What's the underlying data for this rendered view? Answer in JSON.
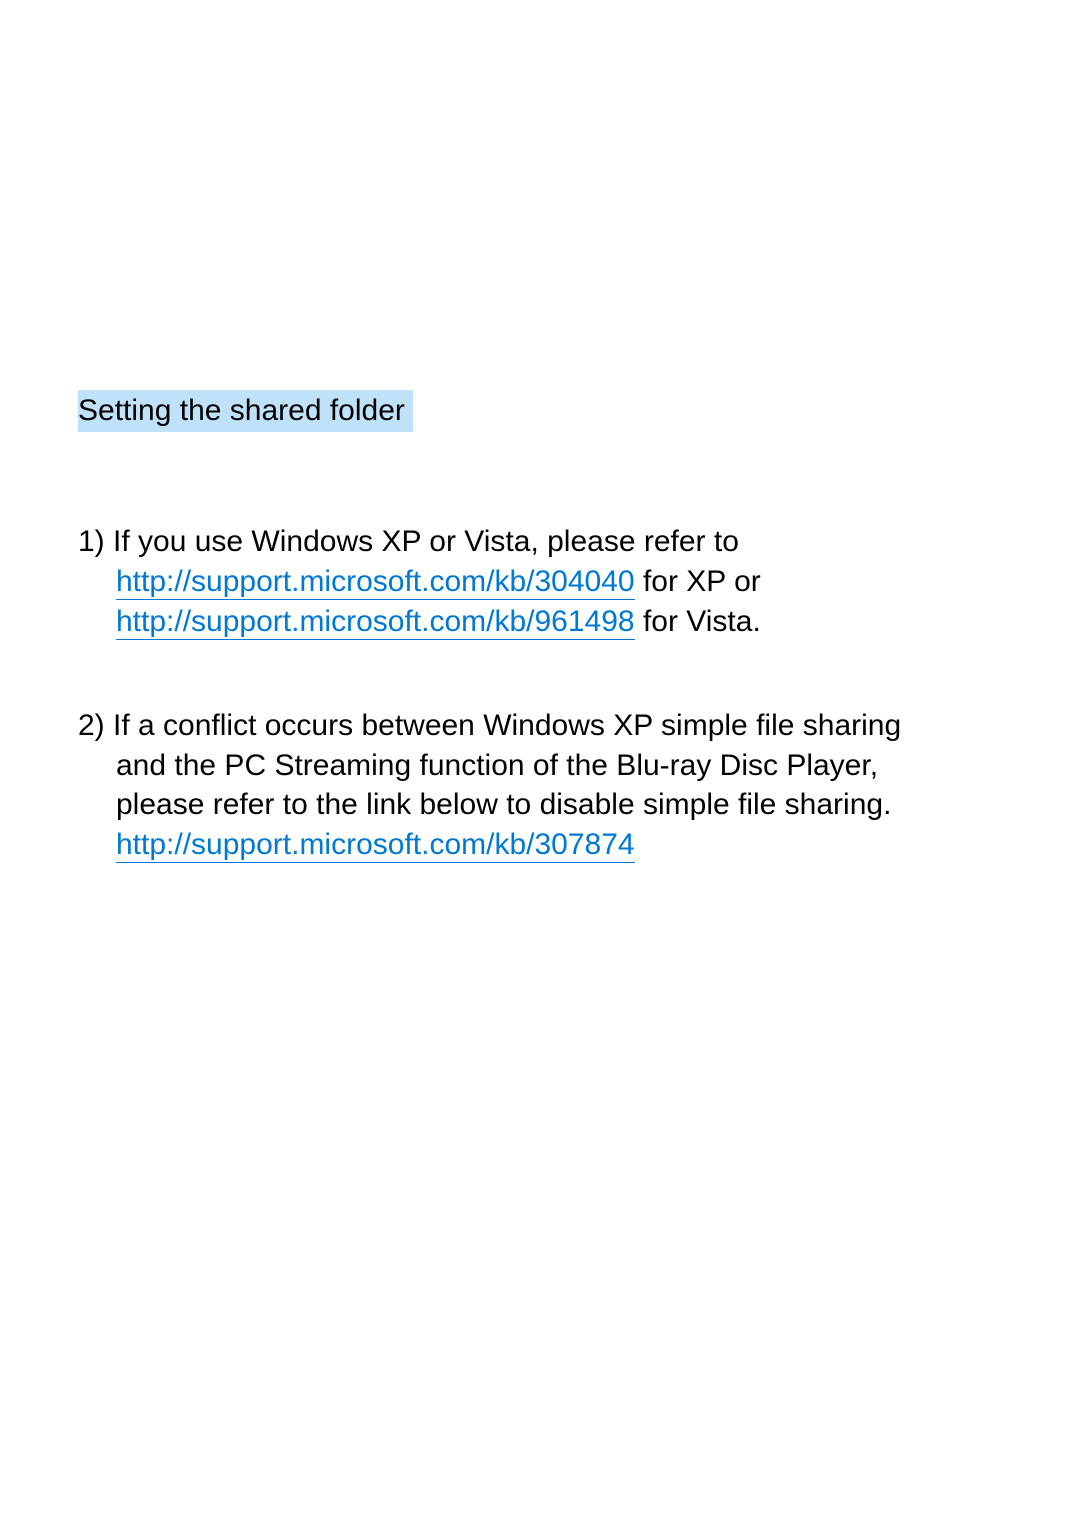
{
  "heading": "Setting the shared folder",
  "items": [
    {
      "number": "1)",
      "text_start": " If you use Windows XP or Vista, please refer to",
      "link1": "http://support.microsoft.com/kb/304040",
      "mid1": " for XP or",
      "link2": "http://support.microsoft.com/kb/961498",
      "mid2": " for Vista."
    },
    {
      "number": "2)",
      "text_start": " If a conflict occurs between Windows XP simple file sharing",
      "text_cont1": "and the PC Streaming function of the Blu-ray Disc Player,",
      "text_cont2": "please refer to the link below to disable simple file sharing.",
      "link1": "http://support.microsoft.com/kb/307874"
    }
  ]
}
